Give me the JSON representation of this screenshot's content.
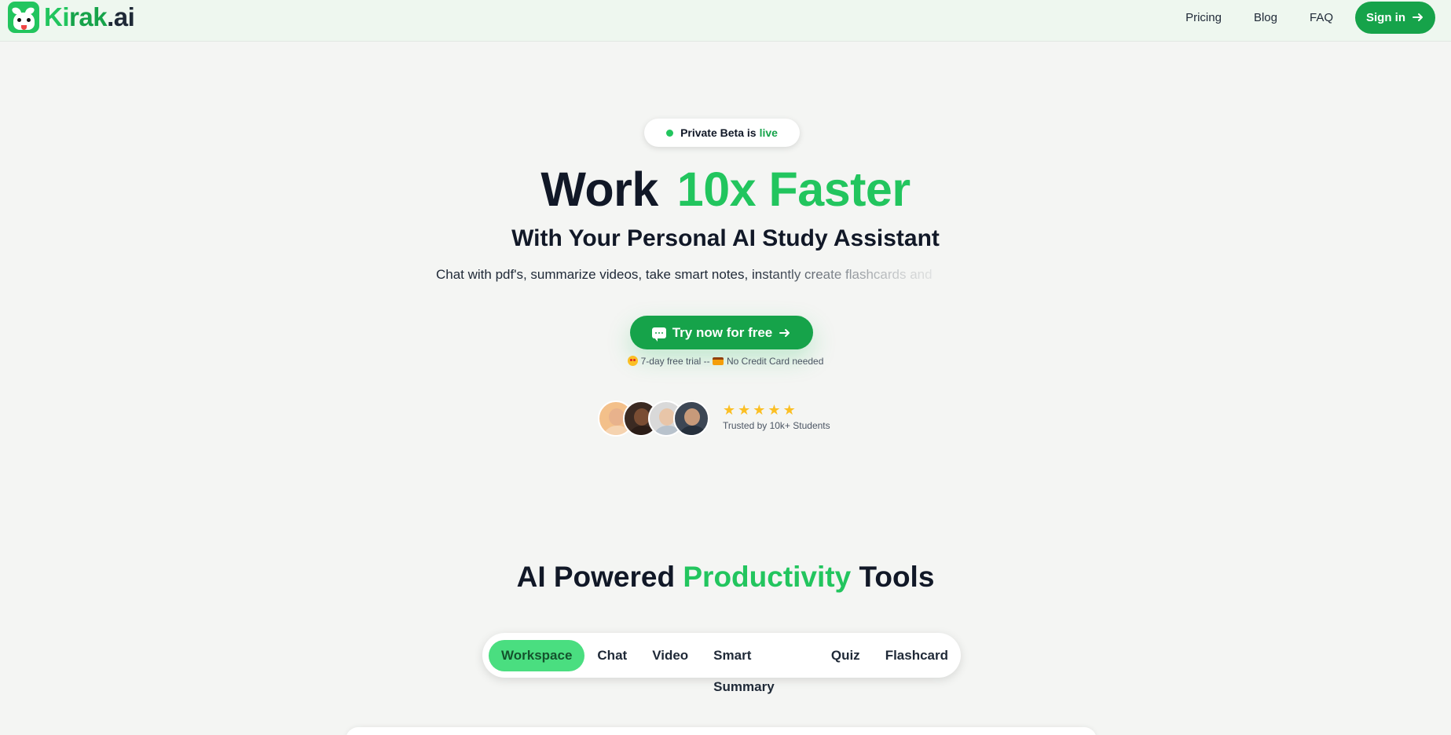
{
  "brand": {
    "name_part1": "Ki",
    "name_part2": "rak",
    "name_part3": ".ai",
    "accent": "#22c55e",
    "accent_dark": "#16a34a"
  },
  "nav": {
    "links": [
      "Pricing",
      "Blog",
      "FAQ"
    ],
    "signin_label": "Sign in",
    "signin_icon": "arrow-right-icon"
  },
  "badge": {
    "text": "Private Beta is",
    "highlight": "live"
  },
  "hero": {
    "title_dark": "Work",
    "title_green": "10x Faster",
    "subtitle": "With Your Personal AI Study Assistant",
    "description": "Chat with pdf's, summarize videos, take smart notes, instantly create flashcards and"
  },
  "cta": {
    "label": "Try now for free",
    "icon": "chat-icon",
    "trailing_icon": "arrow-right-icon"
  },
  "trial": {
    "part1": "7-day free trial --",
    "part2": "No Credit Card needed"
  },
  "social_proof": {
    "rating": 5,
    "trusted_text": "Trusted by 10k+ Students"
  },
  "section": {
    "title_pre": "AI Powered",
    "title_hl": "Productivity",
    "title_post": "Tools"
  },
  "tabs": [
    "Workspace",
    "Chat",
    "Video",
    "Smart Summary",
    "Quiz",
    "Flashcard"
  ],
  "active_tab": "Workspace"
}
